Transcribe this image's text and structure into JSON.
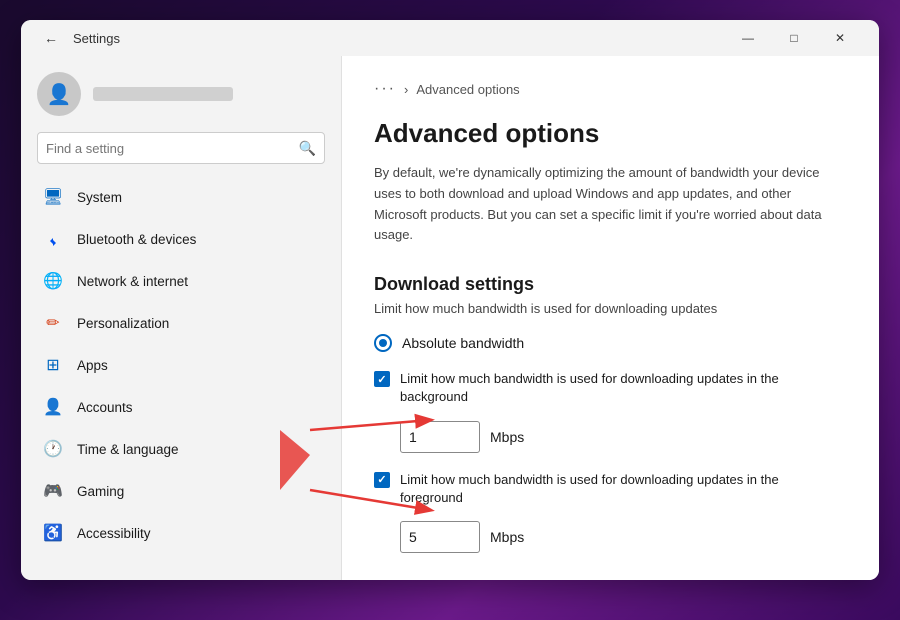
{
  "window": {
    "title": "Settings",
    "controls": {
      "minimize": "—",
      "maximize": "□",
      "close": "✕"
    }
  },
  "sidebar": {
    "search_placeholder": "Find a setting",
    "nav_items": [
      {
        "id": "system",
        "label": "System",
        "icon": "🖥",
        "color_class": "icon-system"
      },
      {
        "id": "bluetooth",
        "label": "Bluetooth & devices",
        "icon": "✦",
        "color_class": "icon-bluetooth"
      },
      {
        "id": "network",
        "label": "Network & internet",
        "icon": "◈",
        "color_class": "icon-network"
      },
      {
        "id": "personalization",
        "label": "Personalization",
        "icon": "✏",
        "color_class": "icon-personalization"
      },
      {
        "id": "apps",
        "label": "Apps",
        "icon": "⊞",
        "color_class": "icon-apps"
      },
      {
        "id": "accounts",
        "label": "Accounts",
        "icon": "👤",
        "color_class": "icon-accounts"
      },
      {
        "id": "time",
        "label": "Time & language",
        "icon": "🕐",
        "color_class": "icon-time"
      },
      {
        "id": "gaming",
        "label": "Gaming",
        "icon": "🎮",
        "color_class": "icon-gaming"
      },
      {
        "id": "accessibility",
        "label": "Accessibility",
        "icon": "♿",
        "color_class": "icon-accessibility"
      }
    ]
  },
  "main": {
    "breadcrumb_dots": "···",
    "breadcrumb_arrow": "›",
    "breadcrumb_label": "Advanced options",
    "page_title": "Advanced options",
    "description": "By default, we're dynamically optimizing the amount of bandwidth your device uses to both download and upload Windows and app updates, and other Microsoft products. But you can set a specific limit if you're worried about data usage.",
    "download_section_title": "Download settings",
    "download_section_subtitle": "Limit how much bandwidth is used for downloading updates",
    "radio_label": "Absolute bandwidth",
    "checkbox1_label": "Limit how much bandwidth is used for downloading updates in the background",
    "input1_value": "1",
    "unit1": "Mbps",
    "checkbox2_label": "Limit how much bandwidth is used for downloading updates in the foreground",
    "input2_value": "5",
    "unit2": "Mbps"
  }
}
